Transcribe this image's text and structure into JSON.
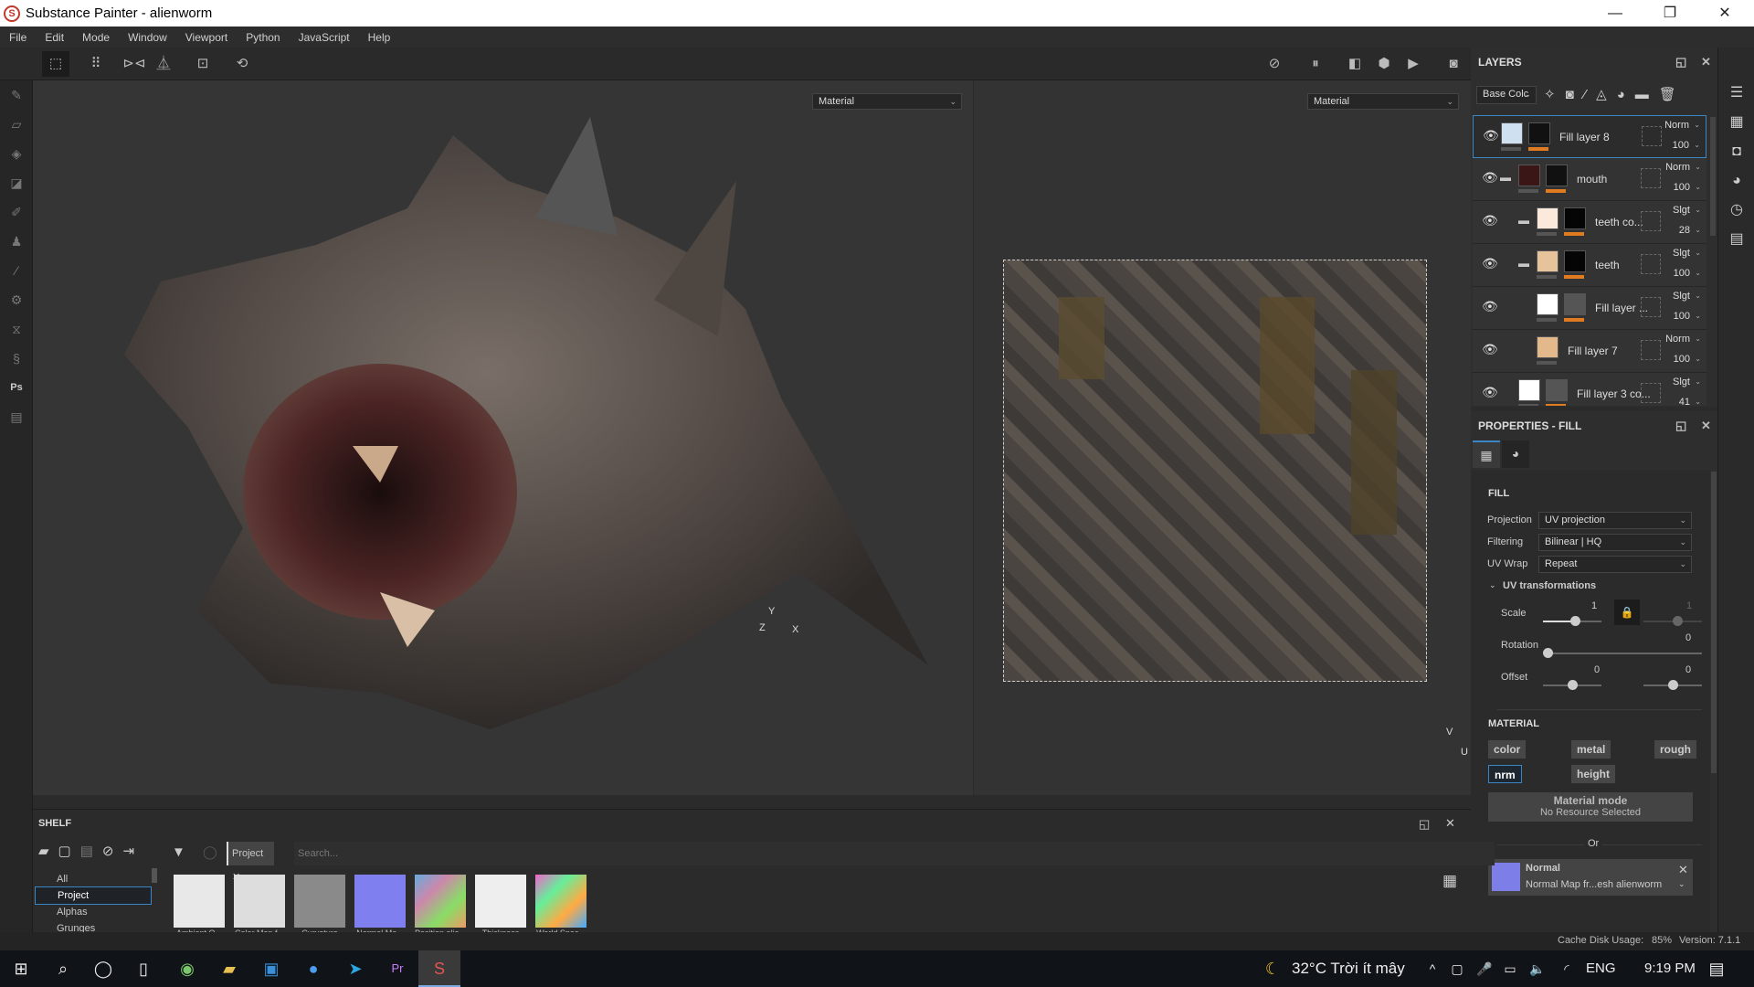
{
  "window": {
    "title": "Substance Painter - alienworm",
    "minimize": "—",
    "restore": "❐",
    "close": "✕"
  },
  "menu": [
    "File",
    "Edit",
    "Mode",
    "Window",
    "Viewport",
    "Python",
    "JavaScript",
    "Help"
  ],
  "viewport": {
    "left_channel": "Material",
    "right_channel": "Material",
    "axis3d": {
      "y": "Y",
      "z": "Z",
      "x": "X"
    },
    "axis2d": {
      "v": "V",
      "u": "U"
    }
  },
  "layers": {
    "title": "LAYERS",
    "channel": "Base Colc",
    "items": [
      {
        "name": "Fill layer 8",
        "blend": "Norm",
        "opacity": "100",
        "thumb": "#cfe0f0",
        "mask": "#111"
      },
      {
        "name": "mouth",
        "blend": "Norm",
        "opacity": "100",
        "thumb": "#3a1616",
        "mask": "#111"
      },
      {
        "name": "teeth co...",
        "blend": "Slgt",
        "opacity": "28",
        "thumb": "#fbe9dc",
        "mask": "#050505"
      },
      {
        "name": "teeth",
        "blend": "Slgt",
        "opacity": "100",
        "thumb": "#e6c39a",
        "mask": "#050505"
      },
      {
        "name": "Fill layer ...",
        "blend": "Slgt",
        "opacity": "100",
        "thumb": "#ffffff",
        "mask": "#555"
      },
      {
        "name": "Fill layer 7",
        "blend": "Norm",
        "opacity": "100",
        "thumb": "#e3b98b",
        "mask": ""
      },
      {
        "name": "Fill layer 3 co...",
        "blend": "Slgt",
        "opacity": "41",
        "thumb": "#ffffff",
        "mask": "#555"
      }
    ]
  },
  "properties": {
    "title": "PROPERTIES - FILL",
    "fill_heading": "FILL",
    "projection": {
      "label": "Projection",
      "value": "UV projection"
    },
    "filtering": {
      "label": "Filtering",
      "value": "Bilinear | HQ"
    },
    "uvwrap": {
      "label": "UV Wrap",
      "value": "Repeat"
    },
    "uvt": "UV transformations",
    "scale": {
      "label": "Scale",
      "u": "1",
      "v": "1",
      "fraction": 0.55
    },
    "rotation": {
      "label": "Rotation",
      "value": "0",
      "fraction": 0
    },
    "offset": {
      "label": "Offset",
      "u": "0",
      "v": "0",
      "fraction": 0.5
    },
    "material_heading": "MATERIAL",
    "channels": [
      "color",
      "metal",
      "rough",
      "nrm",
      "height"
    ],
    "mode_title": "Material mode",
    "mode_sub": "No Resource Selected",
    "or": "Or",
    "resource": {
      "title": "Normal",
      "sub": "Normal Map fr...esh alienworm"
    }
  },
  "shelf": {
    "title": "SHELF",
    "filter_tag": "Project",
    "search_placeholder": "Search...",
    "categories": [
      "All",
      "Project",
      "Alphas",
      "Grunges"
    ],
    "items": [
      "Ambient O...",
      "Color Map f...",
      "Curvature",
      "Normal Ma...",
      "Position alie...",
      "Thickness",
      "World Spac..."
    ]
  },
  "status": {
    "cache_label": "Cache Disk Usage:",
    "cache_value": "85%",
    "version": "Version: 7.1.1"
  },
  "taskbar": {
    "weather": "32°C  Trời ít mây",
    "lang": "ENG",
    "time": "9:19 PM"
  }
}
